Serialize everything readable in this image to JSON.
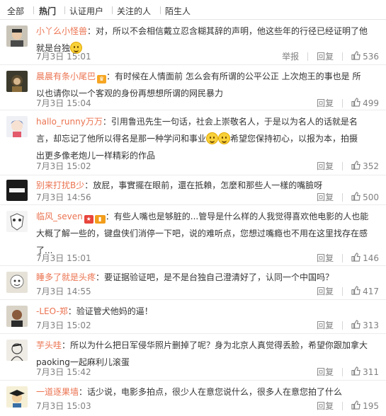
{
  "filters": {
    "tabs": [
      "全部",
      "热门",
      "认证用户",
      "关注的人",
      "陌生人"
    ],
    "active": "热门"
  },
  "actions": {
    "report": "举报",
    "reply": "回复"
  },
  "colors": {
    "username": "#eb7350",
    "meta": "#808080",
    "text": "#333333",
    "divider": "#ececec"
  },
  "comments": [
    {
      "user": "小丫么小怪兽",
      "separator": "：",
      "lines": [
        "对，所以不会相信戴立忍含糊其辞的声明，他这些年的行径已经证明了他",
        "就是台独"
      ],
      "emoji": "smile-emoji",
      "time": "7月3日 15:01",
      "report": true,
      "likes": "536",
      "avatar": "avatar-face-icon"
    },
    {
      "user": "晨晨有条小尾巴",
      "badge": "crown-badge",
      "separator": "：",
      "lines": [
        "有时候在人情面前 怎么会有所谓的公平公正 上次炮王的事也是 所",
        "以也请你以一个客观的身份再想想所谓的网民暴力"
      ],
      "time": "7月3日 15:04",
      "likes": "499",
      "avatar": "avatar-girl-icon"
    },
    {
      "user": "hallo_runny万万",
      "separator": "：",
      "lines": [
        "引用鲁迅先生一句话，社会上崇敬名人，于是以为名人的话就是名",
        "言，却忘记了他所以得名是那一种学问和事业",
        "希望您保持初心，以报为本，拍摄",
        "出更多像老炮儿一样精彩的作品"
      ],
      "time": "7月3日 15:02",
      "likes": "352",
      "avatar": "avatar-anime-icon"
    },
    {
      "user": "别来打扰B少",
      "separator": "：",
      "lines": [
        "放屁，事實擺在眼前，還在抵賴，怎麼和那些人一樣的嘴臉呀"
      ],
      "time": "7月3日 14:56",
      "likes": "500",
      "avatar": "avatar-dark-icon"
    },
    {
      "user": "临风_seven",
      "badge": "star-badge",
      "badge2": "flag-badge",
      "separator": "：",
      "lines": [
        "有些人嘴也是够脏的...管导是什么样的人我觉得喜欢他电影的人也能",
        "大概了解一些的，键盘侠们消停一下吧，说的难听点，您想过嘴瘾也不用在这里找存在感",
        "了..."
      ],
      "time": "7月3日 15:01",
      "likes": "146",
      "avatar": "avatar-mask-icon"
    },
    {
      "user": "睡多了就是头疼",
      "separator": "：",
      "lines": [
        "要证据验证吧，是不是台独自己澄清好了，认同一个中国吗？"
      ],
      "time": "7月3日 14:55",
      "likes": "417",
      "avatar": "avatar-cartoon-icon"
    },
    {
      "user": "-LEO-郑",
      "separator": "：",
      "lines": [
        "验证管犬他妈的逼！"
      ],
      "time": "7月3日 15:02",
      "likes": "313",
      "avatar": "avatar-man-icon"
    },
    {
      "user": "芋头哇",
      "separator": "：",
      "lines": [
        "所以为什么把日军侵华照片删掉了呢？身为北京人真觉得丢脸，希望你跟加拿大",
        "paoking一起麻利儿滚蛋"
      ],
      "time": "7月3日 15:42",
      "likes": "311",
      "avatar": "avatar-sketch-icon"
    },
    {
      "user": "一道逐果墙",
      "separator": "：",
      "lines": [
        "话少说，电影多拍点，很少人在意您说什么，很多人在意您拍了什么"
      ],
      "time": "7月3日 15:03",
      "likes": "195",
      "avatar": "avatar-grad-icon"
    }
  ]
}
